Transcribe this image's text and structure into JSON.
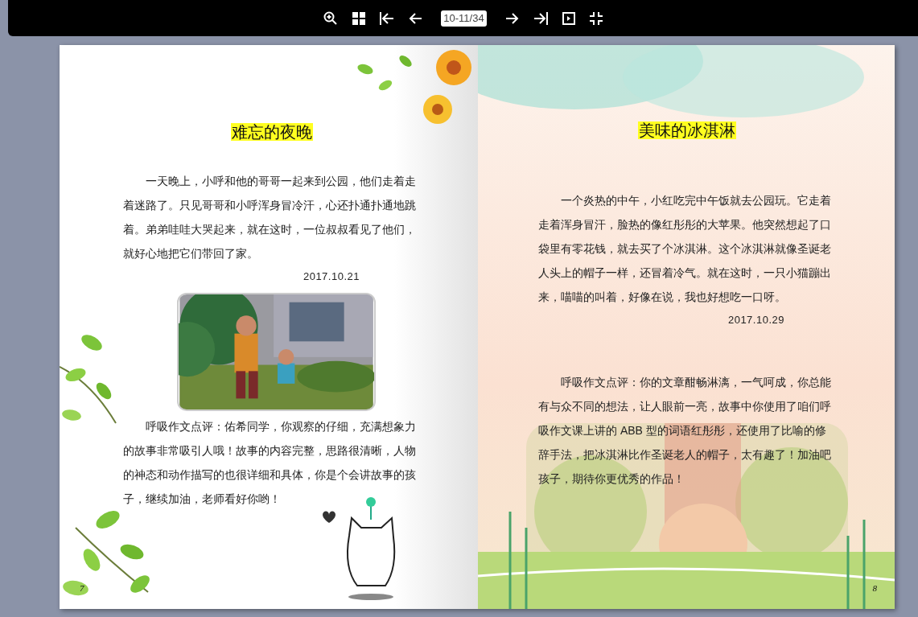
{
  "toolbar": {
    "page_indicator": "10-11/34"
  },
  "pages": [
    {
      "title": "难忘的夜晚",
      "body": "一天晚上，小呼和他的哥哥一起来到公园，他们走着走着迷路了。只见哥哥和小呼浑身冒冷汗，心还扑通扑通地跳着。弟弟哇哇大哭起来，就在这时，一位叔叔看见了他们，就好心地把它们带回了家。",
      "date": "2017.10.21",
      "comment": "呼吸作文点评：佑希同学，你观察的仔细，充满想象力的故事非常吸引人哦！故事的内容完整，思路很清晰，人物的神态和动作描写的也很详细和具体，你是个会讲故事的孩子，继续加油，老师看好你哟！",
      "page_number": "7"
    },
    {
      "title": "美味的冰淇淋",
      "body": "一个炎热的中午，小红吃完中午饭就去公园玩。它走着走着浑身冒汗，脸热的像红彤彤的大苹果。他突然想起了口袋里有零花钱，就去买了个冰淇淋。这个冰淇淋就像圣诞老人头上的帽子一样，还冒着冷气。就在这时，一只小猫蹦出来，喵喵的叫着，好像在说，我也好想吃一口呀。",
      "date": "2017.10.29",
      "comment": "呼吸作文点评：你的文章酣畅淋漓，一气呵成，你总能有与众不同的想法，让人眼前一亮，故事中你使用了咱们呼吸作文课上讲的 ABB 型的词语红彤彤，还使用了比喻的修辞手法，把冰淇淋比作圣诞老人的帽子，太有趣了！加油吧孩子，期待你更优秀的作品！",
      "page_number": "8"
    }
  ]
}
